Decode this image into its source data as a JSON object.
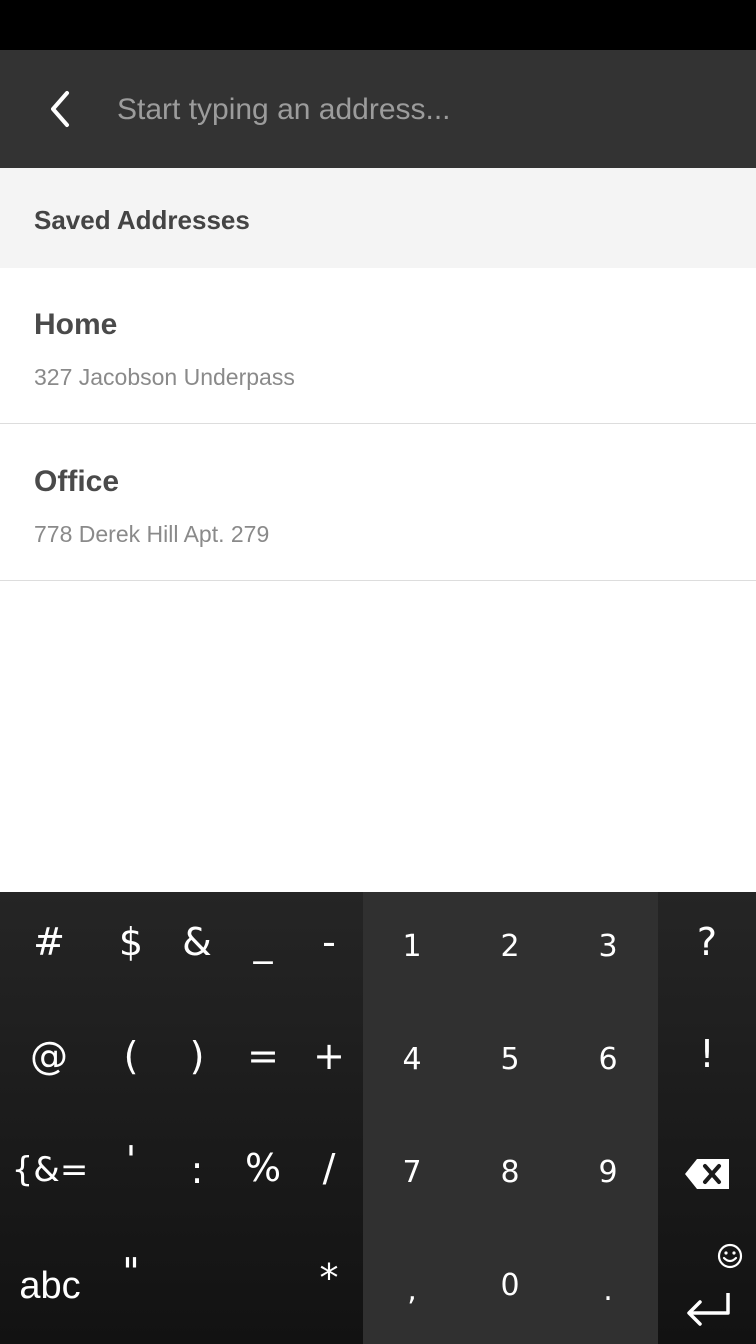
{
  "search": {
    "placeholder": "Start typing an address..."
  },
  "saved": {
    "header": "Saved Addresses",
    "items": [
      {
        "name": "Home",
        "address": "327 Jacobson Underpass"
      },
      {
        "name": "Office",
        "address": "778 Derek Hill Apt. 279"
      }
    ]
  },
  "keyboard": {
    "symbols": {
      "hash": "#",
      "dollar": "$",
      "ampersand": "&",
      "underscore": "_",
      "minus": "-",
      "at": "@",
      "lparen": "(",
      "rparen": ")",
      "equals": "=",
      "plus": "+",
      "more_symbols": "{&=",
      "apostrophe": "'",
      "colon": ":",
      "percent": "%",
      "slash": "/",
      "abc": "abc",
      "quote": "\"",
      "asterisk": "*"
    },
    "numbers": {
      "n1": "1",
      "n2": "2",
      "n3": "3",
      "n4": "4",
      "n5": "5",
      "n6": "6",
      "n7": "7",
      "n8": "8",
      "n9": "9",
      "n0": "0",
      "comma": ",",
      "period": "."
    },
    "right": {
      "question": "?",
      "exclamation": "!"
    },
    "icons": {
      "backspace": "backspace-icon",
      "emoji": "emoji-icon",
      "enter": "enter-icon"
    }
  }
}
